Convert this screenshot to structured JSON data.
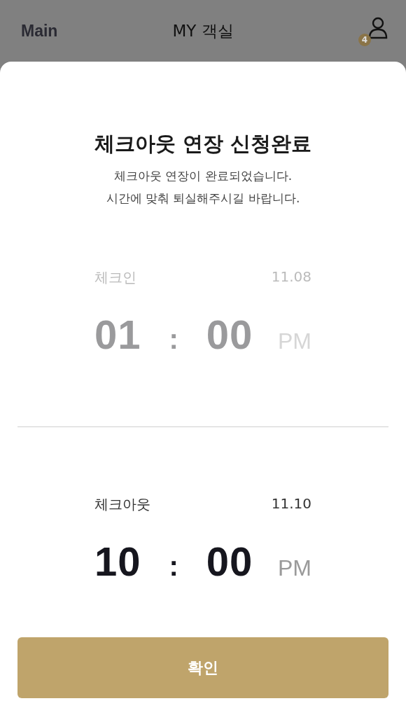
{
  "header": {
    "back_label": "Main",
    "title": "MY 객실",
    "badge": "4"
  },
  "dialog": {
    "title": "체크아웃 연장 신청완료",
    "message_lines": [
      "체크아웃 연장이 완료되었습니다.",
      "시간에 맞춰 퇴실해주시길 바랍니다."
    ],
    "times": [
      {
        "label": "체크인",
        "date": "11.08",
        "hour": "01",
        "separator": ":",
        "minute": "00",
        "period": "PM",
        "active": false
      },
      {
        "label": "체크아웃",
        "date": "11.10",
        "hour": "10",
        "separator": ":",
        "minute": "00",
        "period": "PM",
        "active": true
      }
    ],
    "confirm_button": "확인"
  }
}
